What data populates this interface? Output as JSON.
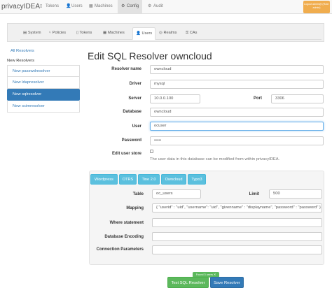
{
  "app": {
    "brand": "privacyIDEA",
    "user_badge": "Logout admin@ (Role: admin)"
  },
  "nav": [
    {
      "icon": "▯",
      "label": "Tokens"
    },
    {
      "icon": "👤",
      "label": "Users"
    },
    {
      "icon": "▦",
      "label": "Machines"
    },
    {
      "icon": "⚙",
      "label": "Config"
    },
    {
      "icon": "⚙",
      "label": "Audit"
    }
  ],
  "subtabs": [
    {
      "icon": "▤",
      "label": "System"
    },
    {
      "icon": "♀",
      "label": "Policies"
    },
    {
      "icon": "▯",
      "label": "Tokens"
    },
    {
      "icon": "▦",
      "label": "Machines"
    },
    {
      "icon": "👤",
      "label": "Users"
    },
    {
      "icon": "◎",
      "label": "Realms"
    },
    {
      "icon": "⚿",
      "label": "CAs"
    }
  ],
  "sidebar": {
    "all_resolvers": "All Resolvers",
    "new_resolvers_heading": "New Resolvers",
    "items": [
      "New passwdresolver",
      "New ldapresolver",
      "New sqlresolver",
      "New scimresolver"
    ]
  },
  "form": {
    "title": "Edit SQL Resolver owncloud",
    "resolver_name_label": "Resolver name",
    "resolver_name": "owncloud",
    "driver_label": "Driver",
    "driver": "mysql",
    "server_label": "Server",
    "server": "10.0.0.100",
    "port_label": "Port",
    "port": "3306",
    "database_label": "Database",
    "database": "owncloud",
    "user_label": "User",
    "user": "ocuser",
    "password_label": "Password",
    "password": "•••••",
    "edit_user_store_label": "Edit user store",
    "edit_user_store_help": "The user data in this database can be modified from within privacyIDEA."
  },
  "presets": [
    "Wordpress",
    "OTRS",
    "Tine 2.0",
    "Owncloud",
    "Typo3"
  ],
  "table_section": {
    "table_label": "Table",
    "table": "oc_users",
    "limit_label": "Limit",
    "limit": "500",
    "mapping_label": "Mapping",
    "mapping": "{ \"userid\" : \"uid\", \"username\": \"uid\", \"givenname\" : \"displayname\", \"password\" : \"password\" }",
    "where_label": "Where statement",
    "where": "",
    "encoding_label": "Database Encoding",
    "encoding": "",
    "conn_params_label": "Connection Parameters",
    "conn_params": ""
  },
  "buttons": {
    "found_badge": "Found 3 users ✕",
    "test": "Test SQL Resolver",
    "save": "Save Resolver"
  }
}
